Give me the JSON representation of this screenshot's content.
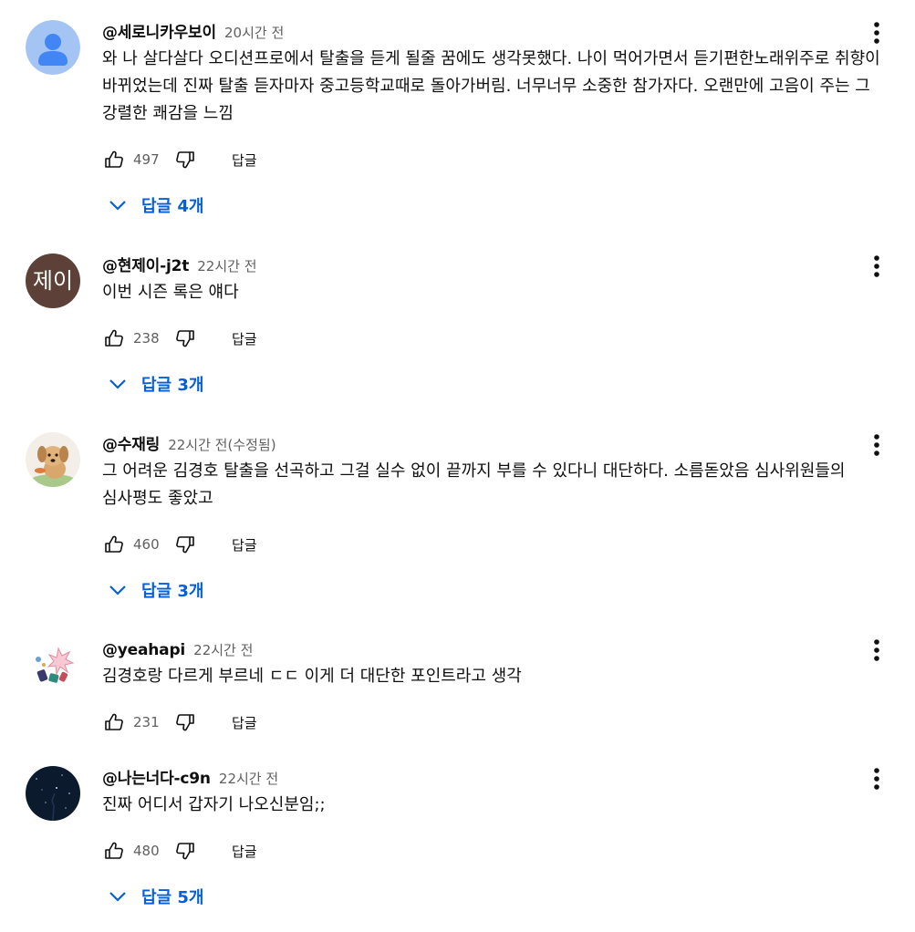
{
  "comments": [
    {
      "author": "@세로니카우보이",
      "time": "20시간 전",
      "text": "와 나 살다살다 오디션프로에서 탈출을 듣게 될줄 꿈에도 생각못했다. 나이 먹어가면서 듣기편한노래위주로 취향이 바뀌었는데 진짜 탈출 듣자마자 중고등학교때로 돌아가버림. 너무너무 소중한 참가자다. 오랜만에 고음이 주는 그 강렬한 쾌감을 느낌",
      "likes": "497",
      "reply_label": "답글",
      "replies_label": "답글 4개",
      "avatar_kind": "default-user-icon"
    },
    {
      "author": "@현제이-j2t",
      "time": "22시간 전",
      "text": "이번 시즌 록은 얘다",
      "likes": "238",
      "reply_label": "답글",
      "replies_label": "답글 3개",
      "avatar_letters": "제이"
    },
    {
      "author": "@수재링",
      "time": "22시간 전(수정됨)",
      "text": "그 어려운 김경호 탈출을 선곡하고 그걸 실수 없이 끝까지 부를 수 있다니 대단하다. 소름돋았음 심사위원들의 심사평도 좋았고",
      "likes": "460",
      "reply_label": "답글",
      "replies_label": "답글 3개",
      "avatar_kind": "puppy-photo"
    },
    {
      "author": "@yeahapi",
      "time": "22시간 전",
      "text": "김경호랑 다르게 부르네 ㄷㄷ 이게 더 대단한 포인트라고 생각",
      "likes": "231",
      "reply_label": "답글",
      "avatar_kind": "illustration"
    },
    {
      "author": "@나는너다-c9n",
      "time": "22시간 전",
      "text": "진짜 어디서 갑자기 나오신분임;;",
      "likes": "480",
      "reply_label": "답글",
      "replies_label": "답글 5개",
      "avatar_kind": "night-sky-photo"
    }
  ],
  "colors": {
    "link": "#065fd4",
    "secondary_text": "#606060",
    "primary_text": "#0f0f0f"
  }
}
